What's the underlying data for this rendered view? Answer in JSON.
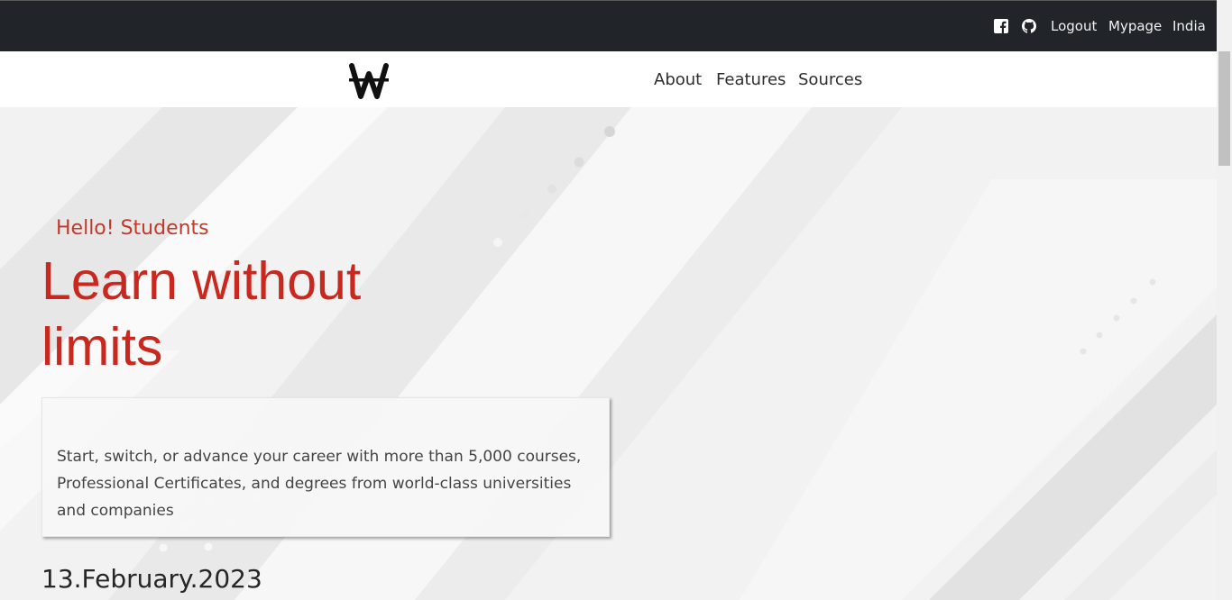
{
  "topbar": {
    "icons": [
      "facebook-icon",
      "github-icon"
    ],
    "links": {
      "logout": "Logout",
      "mypage": "Mypage",
      "region": "India"
    }
  },
  "navbar": {
    "logo_icon": "won-sign-logo",
    "links": {
      "about": "About",
      "features": "Features",
      "sources": "Sources"
    }
  },
  "hero": {
    "greeting": "Hello! Students",
    "headline": "Learn without limits",
    "description": "Start, switch, or advance your career with more than 5,000 courses, Professional Certificates, and degrees from world-class universities and companies",
    "date": "13.February.2023"
  },
  "colors": {
    "topbar_bg": "#212529",
    "accent_red": "#c8281e",
    "hero_bg": "#f3f3f3"
  }
}
